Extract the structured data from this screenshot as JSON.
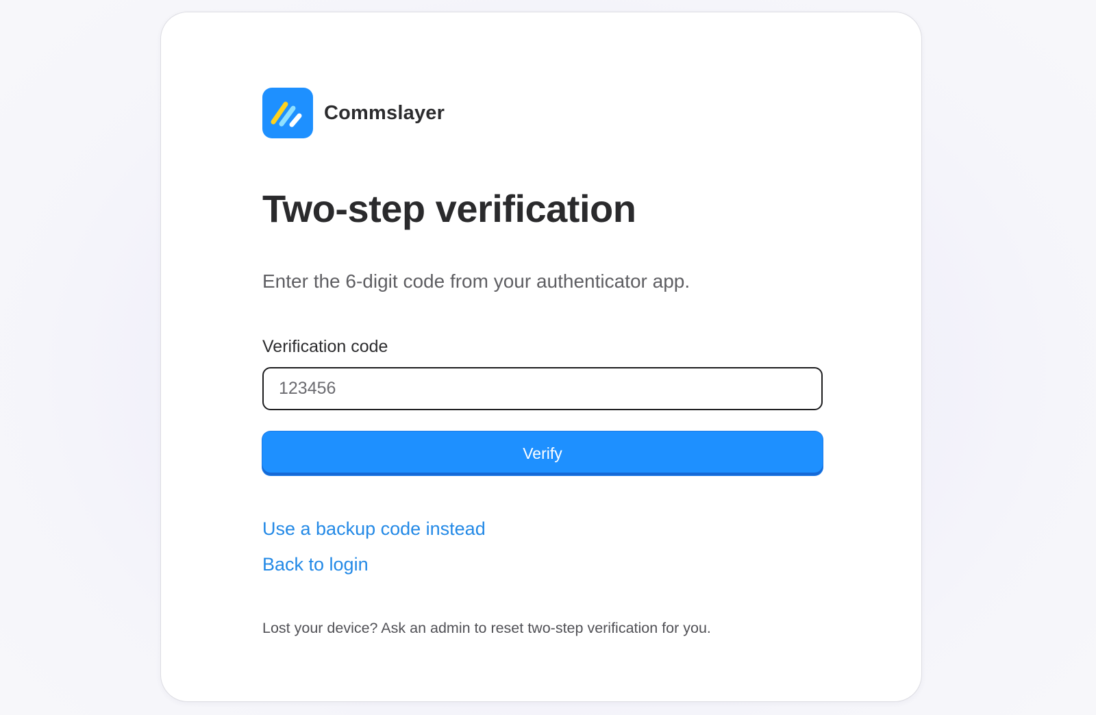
{
  "brand": {
    "name": "Commslayer",
    "logo_icon": "commslayer-logo-icon",
    "logo_color": "#1e90ff"
  },
  "page": {
    "title": "Two-step verification",
    "subtitle": "Enter the 6-digit code from your authenticator app."
  },
  "form": {
    "code_label": "Verification code",
    "code_placeholder": "123456",
    "code_value": "",
    "verify_label": "Verify"
  },
  "links": {
    "backup_code": "Use a backup code instead",
    "back_to_login": "Back to login"
  },
  "help": {
    "lost_device": "Lost your device? Ask an admin to reset two-step verification for you."
  },
  "colors": {
    "accent": "#1e90ff",
    "link": "#2389e6"
  }
}
